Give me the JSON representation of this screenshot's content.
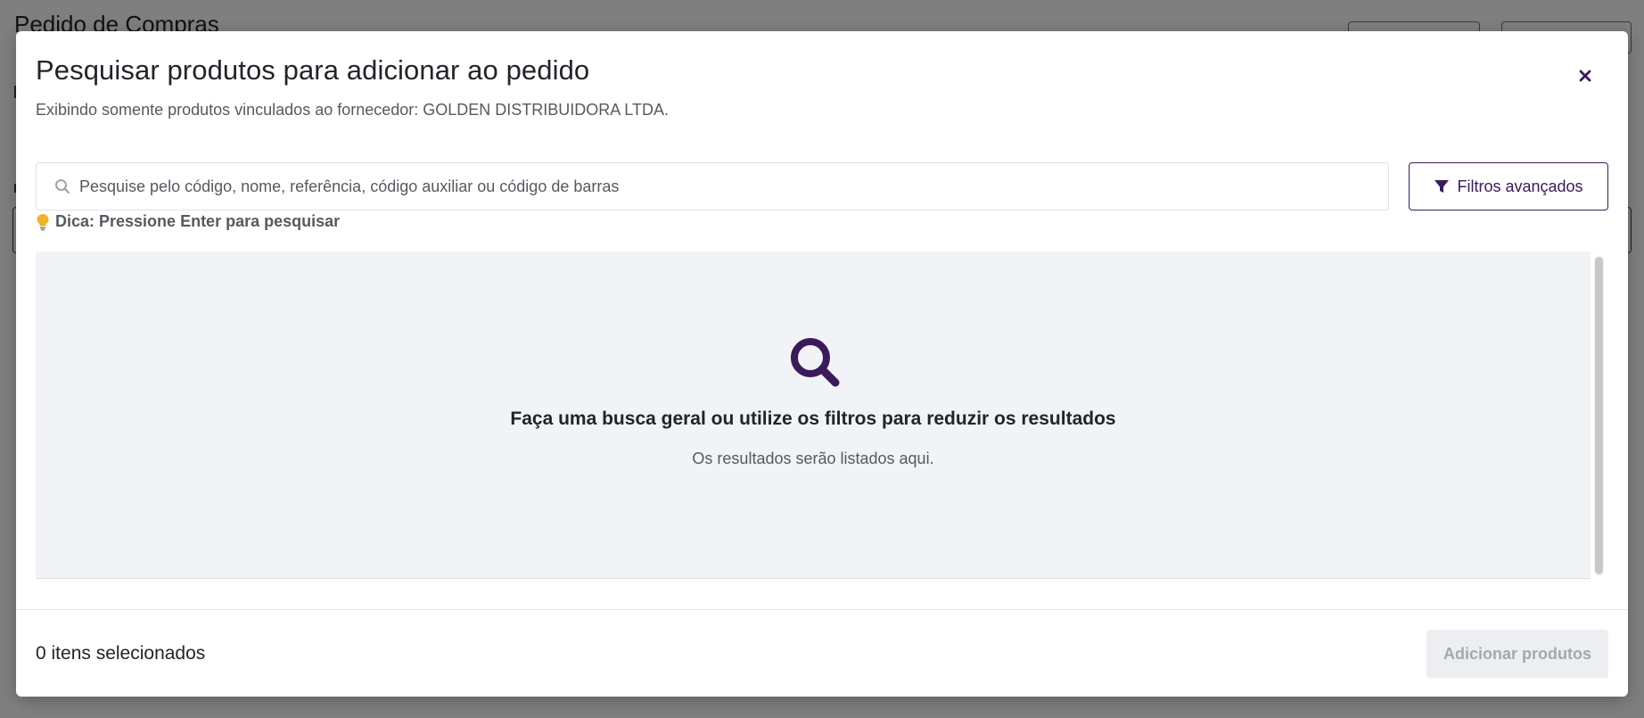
{
  "background": {
    "page_title": "Pedido de Compras"
  },
  "modal": {
    "title": "Pesquisar produtos para adicionar ao pedido",
    "subtitle": "Exibindo somente produtos vinculados ao fornecedor: GOLDEN DISTRIBUIDORA LTDA.",
    "close_icon": "close-icon"
  },
  "search": {
    "placeholder": "Pesquise pelo código, nome, referência, código auxiliar ou código de barras",
    "value": "",
    "icon": "search-icon"
  },
  "filters": {
    "label": "Filtros avançados",
    "icon": "filter-icon"
  },
  "tip": {
    "text": "Dica: Pressione Enter para pesquisar",
    "icon": "lightbulb-icon"
  },
  "results": {
    "icon": "magnifier-icon",
    "heading": "Faça uma busca geral ou utilize os filtros para reduzir os resultados",
    "subtext": "Os resultados serão listados aqui."
  },
  "footer": {
    "selected_count": "0 itens selecionados",
    "add_button": "Adicionar produtos"
  },
  "colors": {
    "accent": "#3b1a5a",
    "results_bg": "#f2f3f7",
    "disabled_btn_bg": "#eceef2",
    "tip_icon": "#f0b429"
  }
}
